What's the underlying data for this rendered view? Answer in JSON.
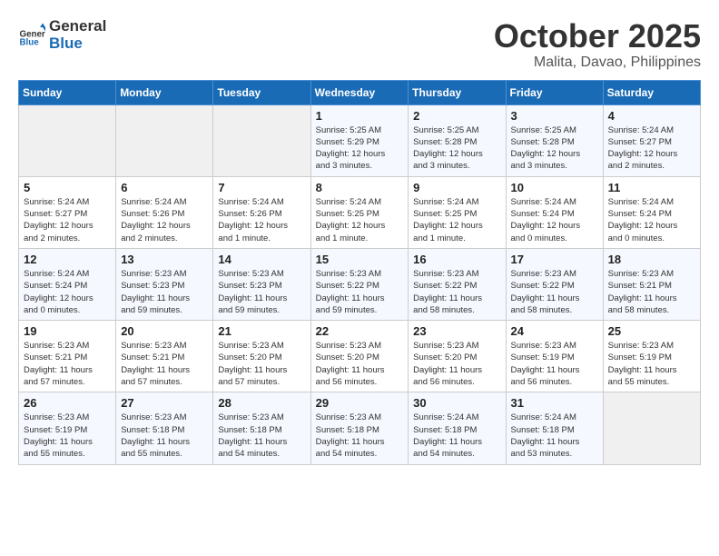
{
  "logo": {
    "text_general": "General",
    "text_blue": "Blue"
  },
  "header": {
    "month": "October 2025",
    "location": "Malita, Davao, Philippines"
  },
  "weekdays": [
    "Sunday",
    "Monday",
    "Tuesday",
    "Wednesday",
    "Thursday",
    "Friday",
    "Saturday"
  ],
  "weeks": [
    [
      {
        "day": "",
        "info": ""
      },
      {
        "day": "",
        "info": ""
      },
      {
        "day": "",
        "info": ""
      },
      {
        "day": "1",
        "info": "Sunrise: 5:25 AM\nSunset: 5:29 PM\nDaylight: 12 hours\nand 3 minutes."
      },
      {
        "day": "2",
        "info": "Sunrise: 5:25 AM\nSunset: 5:28 PM\nDaylight: 12 hours\nand 3 minutes."
      },
      {
        "day": "3",
        "info": "Sunrise: 5:25 AM\nSunset: 5:28 PM\nDaylight: 12 hours\nand 3 minutes."
      },
      {
        "day": "4",
        "info": "Sunrise: 5:24 AM\nSunset: 5:27 PM\nDaylight: 12 hours\nand 2 minutes."
      }
    ],
    [
      {
        "day": "5",
        "info": "Sunrise: 5:24 AM\nSunset: 5:27 PM\nDaylight: 12 hours\nand 2 minutes."
      },
      {
        "day": "6",
        "info": "Sunrise: 5:24 AM\nSunset: 5:26 PM\nDaylight: 12 hours\nand 2 minutes."
      },
      {
        "day": "7",
        "info": "Sunrise: 5:24 AM\nSunset: 5:26 PM\nDaylight: 12 hours\nand 1 minute."
      },
      {
        "day": "8",
        "info": "Sunrise: 5:24 AM\nSunset: 5:25 PM\nDaylight: 12 hours\nand 1 minute."
      },
      {
        "day": "9",
        "info": "Sunrise: 5:24 AM\nSunset: 5:25 PM\nDaylight: 12 hours\nand 1 minute."
      },
      {
        "day": "10",
        "info": "Sunrise: 5:24 AM\nSunset: 5:24 PM\nDaylight: 12 hours\nand 0 minutes."
      },
      {
        "day": "11",
        "info": "Sunrise: 5:24 AM\nSunset: 5:24 PM\nDaylight: 12 hours\nand 0 minutes."
      }
    ],
    [
      {
        "day": "12",
        "info": "Sunrise: 5:24 AM\nSunset: 5:24 PM\nDaylight: 12 hours\nand 0 minutes."
      },
      {
        "day": "13",
        "info": "Sunrise: 5:23 AM\nSunset: 5:23 PM\nDaylight: 11 hours\nand 59 minutes."
      },
      {
        "day": "14",
        "info": "Sunrise: 5:23 AM\nSunset: 5:23 PM\nDaylight: 11 hours\nand 59 minutes."
      },
      {
        "day": "15",
        "info": "Sunrise: 5:23 AM\nSunset: 5:22 PM\nDaylight: 11 hours\nand 59 minutes."
      },
      {
        "day": "16",
        "info": "Sunrise: 5:23 AM\nSunset: 5:22 PM\nDaylight: 11 hours\nand 58 minutes."
      },
      {
        "day": "17",
        "info": "Sunrise: 5:23 AM\nSunset: 5:22 PM\nDaylight: 11 hours\nand 58 minutes."
      },
      {
        "day": "18",
        "info": "Sunrise: 5:23 AM\nSunset: 5:21 PM\nDaylight: 11 hours\nand 58 minutes."
      }
    ],
    [
      {
        "day": "19",
        "info": "Sunrise: 5:23 AM\nSunset: 5:21 PM\nDaylight: 11 hours\nand 57 minutes."
      },
      {
        "day": "20",
        "info": "Sunrise: 5:23 AM\nSunset: 5:21 PM\nDaylight: 11 hours\nand 57 minutes."
      },
      {
        "day": "21",
        "info": "Sunrise: 5:23 AM\nSunset: 5:20 PM\nDaylight: 11 hours\nand 57 minutes."
      },
      {
        "day": "22",
        "info": "Sunrise: 5:23 AM\nSunset: 5:20 PM\nDaylight: 11 hours\nand 56 minutes."
      },
      {
        "day": "23",
        "info": "Sunrise: 5:23 AM\nSunset: 5:20 PM\nDaylight: 11 hours\nand 56 minutes."
      },
      {
        "day": "24",
        "info": "Sunrise: 5:23 AM\nSunset: 5:19 PM\nDaylight: 11 hours\nand 56 minutes."
      },
      {
        "day": "25",
        "info": "Sunrise: 5:23 AM\nSunset: 5:19 PM\nDaylight: 11 hours\nand 55 minutes."
      }
    ],
    [
      {
        "day": "26",
        "info": "Sunrise: 5:23 AM\nSunset: 5:19 PM\nDaylight: 11 hours\nand 55 minutes."
      },
      {
        "day": "27",
        "info": "Sunrise: 5:23 AM\nSunset: 5:18 PM\nDaylight: 11 hours\nand 55 minutes."
      },
      {
        "day": "28",
        "info": "Sunrise: 5:23 AM\nSunset: 5:18 PM\nDaylight: 11 hours\nand 54 minutes."
      },
      {
        "day": "29",
        "info": "Sunrise: 5:23 AM\nSunset: 5:18 PM\nDaylight: 11 hours\nand 54 minutes."
      },
      {
        "day": "30",
        "info": "Sunrise: 5:24 AM\nSunset: 5:18 PM\nDaylight: 11 hours\nand 54 minutes."
      },
      {
        "day": "31",
        "info": "Sunrise: 5:24 AM\nSunset: 5:18 PM\nDaylight: 11 hours\nand 53 minutes."
      },
      {
        "day": "",
        "info": ""
      }
    ]
  ]
}
